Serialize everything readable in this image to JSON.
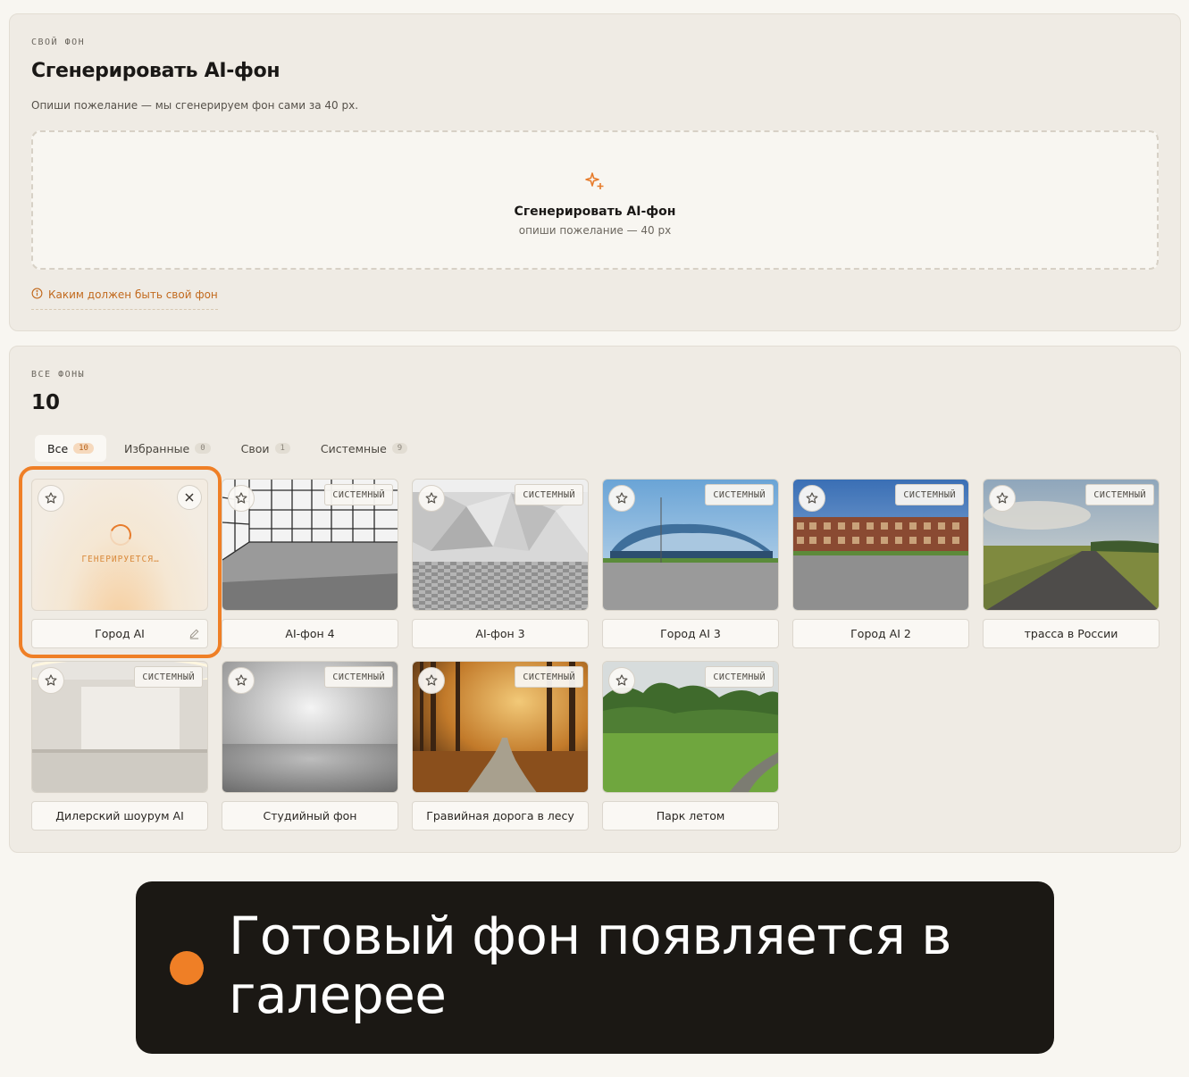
{
  "generator": {
    "eyebrow": "СВОЙ ФОН",
    "title": "Сгенерировать AI-фон",
    "description": "Опиши пожелание — мы сгенерируем фон сами за 40 px.",
    "dropzone_title": "Сгенерировать AI-фон",
    "dropzone_sub": "опиши пожелание — 40 px",
    "help_link": "Каким должен быть свой фон",
    "accent": "#e77c2c"
  },
  "gallery": {
    "eyebrow": "ВСЕ ФОНЫ",
    "count": "10",
    "tabs": [
      {
        "label": "Все",
        "count": "10"
      },
      {
        "label": "Избранные",
        "count": "0"
      },
      {
        "label": "Свои",
        "count": "1"
      },
      {
        "label": "Системные",
        "count": "9"
      }
    ],
    "system_tag": "СИСТЕМНЫЙ",
    "generating_label": "ГЕНЕРИРУЕТСЯ…",
    "items": [
      {
        "name": "Город AI",
        "status": "generating",
        "image": "placeholder-gradient"
      },
      {
        "name": "AI-фон 4",
        "image": "white-tile-room"
      },
      {
        "name": "AI-фон 3",
        "image": "geometric-studio"
      },
      {
        "name": "Город AI 3",
        "image": "arena-parking"
      },
      {
        "name": "Город AI 2",
        "image": "townhouses-lot"
      },
      {
        "name": "трасса в России",
        "image": "country-road"
      },
      {
        "name": "Дилерский шоурум AI",
        "image": "showroom"
      },
      {
        "name": "Студийный фон",
        "image": "studio-cyclorama"
      },
      {
        "name": "Гравийная дорога в лесу",
        "image": "autumn-forest-road"
      },
      {
        "name": "Парк летом",
        "image": "summer-park"
      }
    ]
  },
  "caption": {
    "text": "Готовый фон появляется в галерее",
    "dot_color": "#ef7f26"
  }
}
